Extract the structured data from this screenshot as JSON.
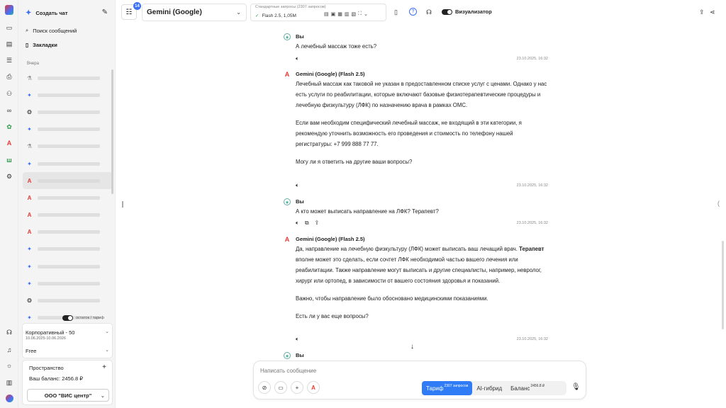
{
  "sidebar": {
    "new_chat": "Создать чат",
    "search": "Поиск сообщений",
    "bookmarks": "Закладки",
    "section_yesterday": "Вчера",
    "remainder_label": "остаток / тариф",
    "plan": {
      "name": "Корпоративный - 50",
      "dates": "10.06.2025-10.06.2026",
      "free": "Free"
    },
    "space": {
      "title": "Пространство",
      "balance": "Ваш баланс: 2456.8 ₽",
      "org": "ООО \"ВИС центр\""
    }
  },
  "topbar": {
    "badge": "14",
    "model": "Gemini (Google)",
    "standard_requests": "Стандартные запросы (2307 запросов)",
    "flash_model": "Flash 2.5, 1,05M",
    "visualizer": "Визуализатор"
  },
  "messages": [
    {
      "role": "user",
      "author": "Вы",
      "paragraphs": [
        "А лечебный массаж тоже есть?"
      ],
      "time": "23.10.2025, 16:32"
    },
    {
      "role": "assistant",
      "author": "Gemini (Google) (Flash 2.5)",
      "paragraphs": [
        "Лечебный массаж как таковой не указан в предоставленном списке услуг с ценами. Однако у нас есть услуги по реабилитации, которые включают базовые физиотерапевтические процедуры и лечебную физкультуру (ЛФК) по назначению врача в рамках ОМС.",
        "Если вам необходим специфический лечебный массаж, не входящий в эти категории, я рекомендую уточнить возможность его проведения и стоимость по телефону нашей регистратуры: +7 999 888 77 77.",
        "Могу ли я ответить на другие ваши вопросы?"
      ],
      "time": "23.10.2025, 16:32"
    },
    {
      "role": "user",
      "author": "Вы",
      "paragraphs": [
        "А кто может выписать направление на ЛФК? Терапевт?"
      ],
      "time": "23.10.2025, 16:32"
    },
    {
      "role": "assistant",
      "author": "Gemini (Google) (Flash 2.5)",
      "p1_plain": "Да, направление на лечебную физкультуру (ЛФК) может выписать ваш лечащий врач.",
      "p1_bold": "Терапевт",
      "p1_rest": " вполне может это сделать, если сочтет ЛФК необходимой частью вашего лечения или реабилитации. Также направление могут выписать и другие специалисты, например, невролог, хирург или ортопед, в зависимости от вашего состояния здоровья и показаний.",
      "paragraphs": [
        "Важно, чтобы направление было обосновано медицинскими показаниями.",
        "Есть ли у вас еще вопросы?"
      ],
      "time": "23.10.2025, 16:32"
    },
    {
      "role": "user",
      "author": "Вы"
    }
  ],
  "composer": {
    "placeholder": "Написать сообщение",
    "tariff": "Тариф",
    "tariff_count": "2307 запросов",
    "hybrid": "AI-гибрид",
    "balance": "Баланс",
    "balance_value": "2456.8 ₽"
  },
  "icons": {
    "user_avatar": "user-avatar-icon",
    "gemini_avatar": "gemini-a-icon",
    "speaker": "speaker-icon",
    "copy": "copy-icon",
    "share": "share-icon",
    "mic": "mic-icon"
  },
  "colors": {
    "accent": "#2f7cf6",
    "gemini_red": "#e53935",
    "badge": "#3b6ff5"
  }
}
